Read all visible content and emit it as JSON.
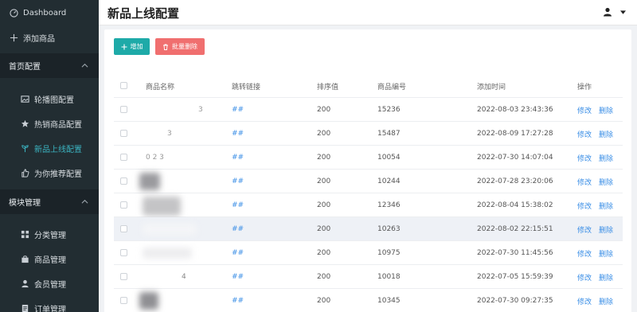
{
  "sidebar": {
    "items": [
      {
        "label": "Dashboard",
        "icon": "dashboard-icon",
        "top": true
      },
      {
        "label": "添加商品",
        "icon": "plus-icon",
        "top": true
      }
    ],
    "groups": [
      {
        "label": "首页配置"
      },
      {
        "label": "模块管理"
      }
    ],
    "home_items": [
      {
        "label": "轮播图配置",
        "icon": "image-icon"
      },
      {
        "label": "热销商品配置",
        "icon": "star-icon"
      },
      {
        "label": "新品上线配置",
        "icon": "sprout-icon",
        "active": true
      },
      {
        "label": "为你推荐配置",
        "icon": "thumbs-up-icon"
      }
    ],
    "module_items": [
      {
        "label": "分类管理",
        "icon": "grid-icon"
      },
      {
        "label": "商品管理",
        "icon": "shopping-bag-icon"
      },
      {
        "label": "会员管理",
        "icon": "user-icon"
      },
      {
        "label": "订单管理",
        "icon": "order-icon"
      }
    ]
  },
  "header": {
    "title": "新品上线配置"
  },
  "toolbar": {
    "add_label": "增加",
    "batch_delete_label": "批量删除"
  },
  "table": {
    "columns": [
      "商品名称",
      "跳转链接",
      "排序值",
      "商品编号",
      "添加时间",
      "操作"
    ],
    "rows": [
      {
        "name": "3",
        "link": "##",
        "sort": "200",
        "code": "15236",
        "time": "2022-08-03 23:43:36"
      },
      {
        "name": "3",
        "link": "##",
        "sort": "200",
        "code": "15487",
        "time": "2022-08-09 17:27:28"
      },
      {
        "name": "0    2    3",
        "link": "##",
        "sort": "200",
        "code": "10054",
        "time": "2022-07-30 14:07:04"
      },
      {
        "name": "",
        "link": "##",
        "sort": "200",
        "code": "10244",
        "time": "2022-07-28 23:20:06"
      },
      {
        "name": "",
        "link": "##",
        "sort": "200",
        "code": "12346",
        "time": "2022-08-04 15:38:02"
      },
      {
        "name": "",
        "link": "##",
        "sort": "200",
        "code": "10263",
        "time": "2022-08-02 22:15:51"
      },
      {
        "name": "",
        "link": "##",
        "sort": "200",
        "code": "10975",
        "time": "2022-07-30 11:45:56"
      },
      {
        "name": "4",
        "link": "##",
        "sort": "200",
        "code": "10018",
        "time": "2022-07-05 15:59:39"
      },
      {
        "name": "",
        "link": "##",
        "sort": "200",
        "code": "10345",
        "time": "2022-07-30 09:27:35"
      }
    ],
    "edit_label": "修改",
    "delete_label": "删除"
  },
  "colors": {
    "sidebar_bg": "#222d32",
    "accent": "#1eaaa8",
    "danger": "#f06f6f",
    "link": "#3a8ee6",
    "active_menu": "#3bb4c1"
  }
}
